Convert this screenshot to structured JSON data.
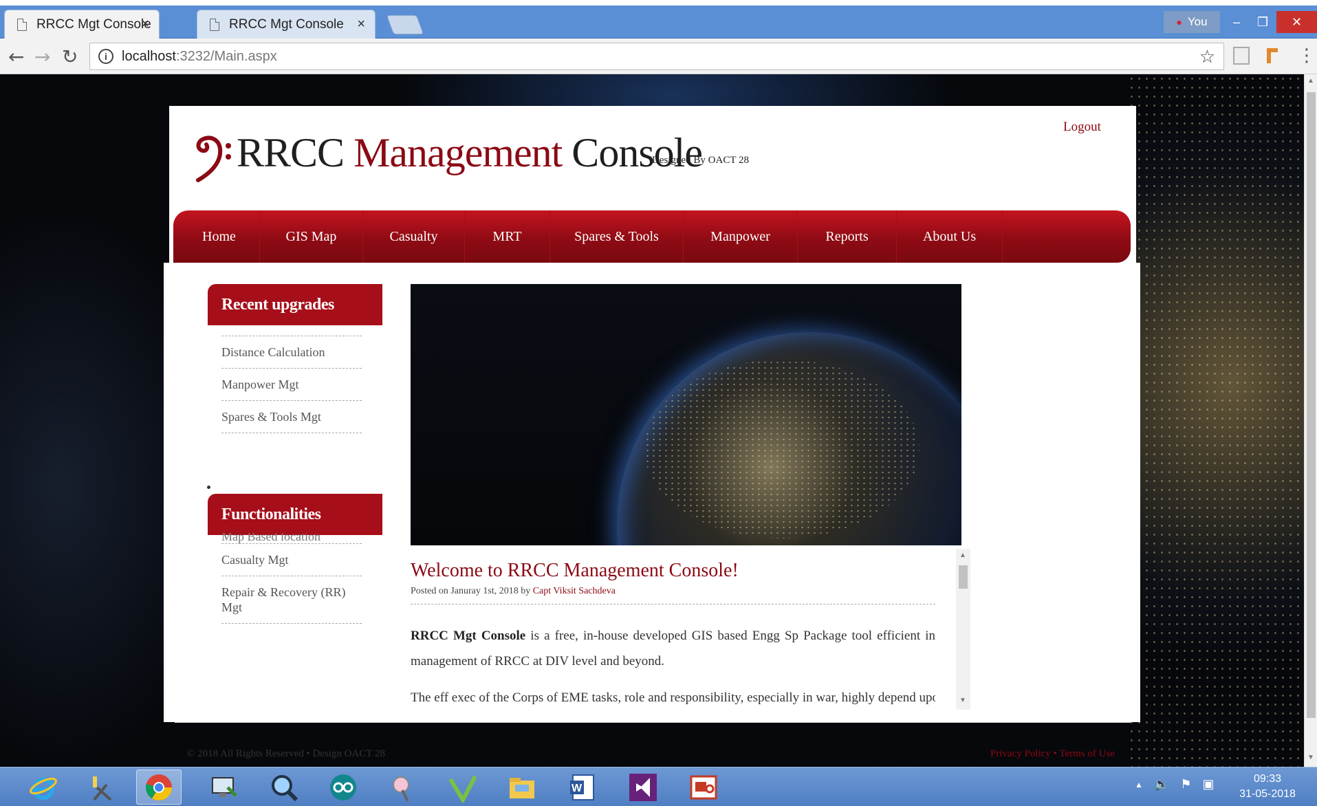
{
  "browser": {
    "tabs": [
      {
        "title": "RRCC Mgt Console",
        "close": "×"
      },
      {
        "title": "RRCC Mgt Console",
        "close": "×"
      }
    ],
    "profile_label": "You",
    "window_controls": {
      "minimize": "–",
      "maximize": "❐",
      "close": "✕"
    },
    "nav": {
      "back": "←",
      "forward": "→",
      "reload": "↻"
    },
    "info_glyph": "i",
    "url_host": "localhost",
    "url_path": ":3232/Main.aspx",
    "bookmark_star": "☆",
    "menu_glyph": "⋮"
  },
  "site": {
    "logo_glyph": "𝄢",
    "title_part1": "RRCC",
    "title_part2": "Management",
    "title_part3": "Console",
    "designed_by": "Designed By OACT 28",
    "logout": "Logout",
    "nav": [
      "Home",
      "GIS Map",
      "Casualty",
      "MRT",
      "Spares & Tools",
      "Manpower",
      "Reports",
      "About Us"
    ],
    "accent_color": "#8b0a14"
  },
  "sidebar": {
    "recent_heading": "Recent upgrades",
    "recent_items": [
      "Distance Calculation",
      "Manpower Mgt",
      "Spares & Tools Mgt"
    ],
    "func_heading": "Functionalities",
    "func_cut_item": "Map Based location",
    "func_items": [
      "Casualty Mgt",
      "Repair & Recovery (RR) Mgt"
    ]
  },
  "article": {
    "title": "Welcome to RRCC Management Console!",
    "posted_prefix": "Posted on Januray 1st, 2018 by",
    "author": "Capt Viksit Sachdeva",
    "para1_bold": "RRCC Mgt Console",
    "para1_rest": " is a free, in-house developed GIS based Engg Sp Package tool efficient in management of RRCC at DIV level and beyond.",
    "para2": "The eff exec of the Corps of EME tasks, role and responsibility, especially in war, highly depend upon"
  },
  "footer": {
    "copyright": "© 2018 All Rights Reserved • Design OACT 28",
    "privacy": "Privacy Policy",
    "separator": " • ",
    "terms": "Terms of Use"
  },
  "taskbar": {
    "apps": [
      "internet-explorer",
      "snipping-tool",
      "chrome",
      "remote-desktop",
      "magnifier",
      "arduino",
      "paint",
      "sketch-app",
      "file-explorer",
      "word",
      "visual-studio",
      "presentation-app"
    ],
    "tray_arrow": "▲",
    "time": "09:33",
    "date": "31-05-2018"
  }
}
